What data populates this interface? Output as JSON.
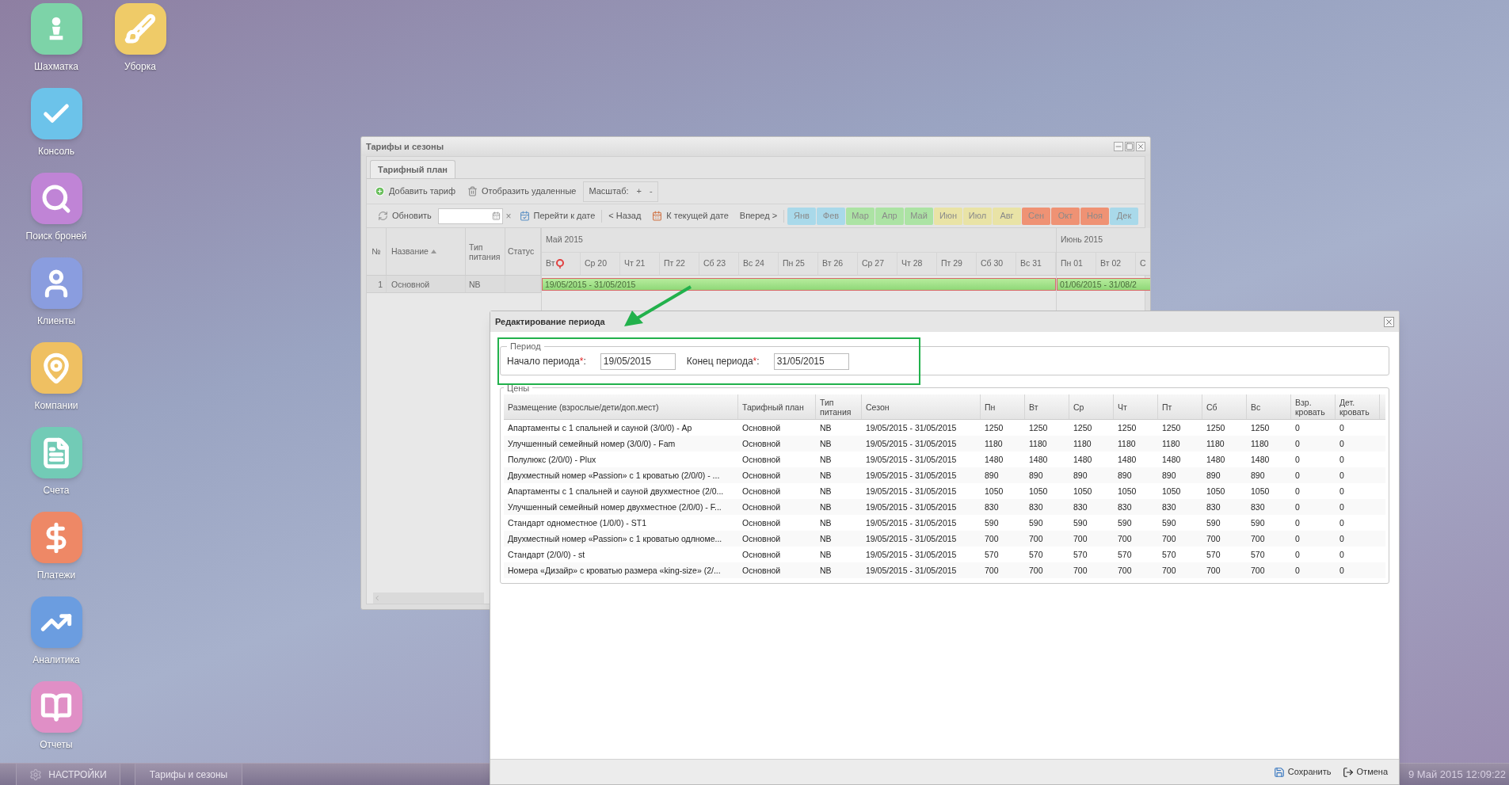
{
  "desktop_icons": [
    {
      "label": "Шахматка",
      "color": "#7dd3a8"
    },
    {
      "label": "Уборка",
      "color": "#efcb68"
    },
    {
      "label": "Консоль",
      "color": "#6cc3ea"
    },
    {
      "label": "Поиск броней",
      "color": "#c084d6"
    },
    {
      "label": "Клиенты",
      "color": "#8a9ddf"
    },
    {
      "label": "Компании",
      "color": "#efc062"
    },
    {
      "label": "Счета",
      "color": "#72cbb6"
    },
    {
      "label": "Платежи",
      "color": "#ee8866"
    },
    {
      "label": "Аналитика",
      "color": "#6b9de0"
    },
    {
      "label": "Отчеты",
      "color": "#e08fc6"
    }
  ],
  "taskbar": {
    "items": [
      {
        "label": "НАСТРОЙКИ",
        "kind": "settings"
      },
      {
        "label": "Тарифы и сезоны",
        "kind": "window"
      }
    ],
    "clock": "9 Май 2015 12:09:22"
  },
  "window": {
    "title": "Тарифы и сезоны",
    "tabs": [
      {
        "label": "Тарифный план",
        "selected": true
      }
    ],
    "toolbar": {
      "buttons": [
        {
          "label": "Добавить тариф",
          "kind": "add"
        },
        {
          "label": "Отобразить удаленные",
          "kind": "trash"
        }
      ],
      "scale": {
        "label": "Масштаб:",
        "zoom_in": "+",
        "zoom_out": "-"
      }
    },
    "navigation": {
      "refresh": "Обновить",
      "clear": "×",
      "go_to_date": "Перейти к дате",
      "back": "< Назад",
      "today": "К текущей дате",
      "forward": "Вперед >",
      "months": [
        {
          "label": "Янв",
          "color": "#a9d9ea"
        },
        {
          "label": "Фев",
          "color": "#a9d9ea"
        },
        {
          "label": "Мар",
          "color": "#ace3a4"
        },
        {
          "label": "Апр",
          "color": "#ace3a4"
        },
        {
          "label": "Май",
          "color": "#ace3a4"
        },
        {
          "label": "Июн",
          "color": "#e9e3a6"
        },
        {
          "label": "Июл",
          "color": "#e9e3a6"
        },
        {
          "label": "Авг",
          "color": "#e9e3a6"
        },
        {
          "label": "Сен",
          "color": "#ef9274"
        },
        {
          "label": "Окт",
          "color": "#ef9274"
        },
        {
          "label": "Ноя",
          "color": "#ef9274"
        },
        {
          "label": "Дек",
          "color": "#a9d9ea"
        }
      ]
    },
    "grid": {
      "columns": [
        {
          "label": "№",
          "sorted": false
        },
        {
          "label": "Название",
          "sorted": true
        },
        {
          "label": "Тип питания",
          "sorted": false
        },
        {
          "label": "Статус",
          "sorted": false
        }
      ],
      "rows": [
        [
          "1",
          "Основной",
          "NB"
        ]
      ]
    },
    "timeline": {
      "months": [
        {
          "label": "Май 2015",
          "bar": "19/05/2015 - 31/05/2015",
          "days": [
            {
              "label": "Вт",
              "today": true
            },
            {
              "label": "Ср 20",
              "today": false
            },
            {
              "label": "Чт 21",
              "today": false
            },
            {
              "label": "Пт 22",
              "today": false
            },
            {
              "label": "Сб 23",
              "today": false
            },
            {
              "label": "Вс 24",
              "today": false
            },
            {
              "label": "Пн 25",
              "today": false
            },
            {
              "label": "Вт 26",
              "today": false
            },
            {
              "label": "Ср 27",
              "today": false
            },
            {
              "label": "Чт 28",
              "today": false
            },
            {
              "label": "Пт 29",
              "today": false
            },
            {
              "label": "Сб 30",
              "today": false
            },
            {
              "label": "Вс 31",
              "today": false
            }
          ]
        },
        {
          "label": "Июнь 2015",
          "bar": "01/06/2015 - 31/08/2",
          "days": [
            {
              "label": "Пн 01",
              "today": false
            },
            {
              "label": "Вт 02",
              "today": false
            },
            {
              "label": "С",
              "today": false
            }
          ]
        }
      ]
    }
  },
  "dialog": {
    "title": "Редактирование периода",
    "period": {
      "legend": "Период",
      "fields": [
        {
          "label": "Начало периода",
          "mark": "*",
          "suffix": ":",
          "value": "19/05/2015"
        },
        {
          "label": "Конец периода",
          "mark": "*",
          "suffix": ":",
          "value": "31/05/2015"
        }
      ]
    },
    "prices": {
      "legend": "Цены",
      "columns": [
        "Размещение (взрослые/дети/доп.мест)",
        "Тарифный план",
        "Тип питания",
        "Сезон",
        "Пн",
        "Вт",
        "Ср",
        "Чт",
        "Пт",
        "Сб",
        "Вс",
        "Взр. кровать",
        "Дет. кровать"
      ],
      "rows": [
        [
          "Апартаменты с 1 спальней и сауной (3/0/0) - Ap",
          "Основной",
          "NB",
          "19/05/2015 - 31/05/2015",
          "1250",
          "1250",
          "1250",
          "1250",
          "1250",
          "1250",
          "1250",
          "0",
          "0"
        ],
        [
          "Улучшенный семейный номер (3/0/0) - Fam",
          "Основной",
          "NB",
          "19/05/2015 - 31/05/2015",
          "1180",
          "1180",
          "1180",
          "1180",
          "1180",
          "1180",
          "1180",
          "0",
          "0"
        ],
        [
          "Полулюкс (2/0/0) - Plux",
          "Основной",
          "NB",
          "19/05/2015 - 31/05/2015",
          "1480",
          "1480",
          "1480",
          "1480",
          "1480",
          "1480",
          "1480",
          "0",
          "0"
        ],
        [
          "Двухместный номер «Passion» с 1 кроватью (2/0/0) - ...",
          "Основной",
          "NB",
          "19/05/2015 - 31/05/2015",
          "890",
          "890",
          "890",
          "890",
          "890",
          "890",
          "890",
          "0",
          "0"
        ],
        [
          "Апартаменты с 1 спальней и сауной двухместное (2/0...",
          "Основной",
          "NB",
          "19/05/2015 - 31/05/2015",
          "1050",
          "1050",
          "1050",
          "1050",
          "1050",
          "1050",
          "1050",
          "0",
          "0"
        ],
        [
          "Улучшенный семейный номер двухместное (2/0/0) - F...",
          "Основной",
          "NB",
          "19/05/2015 - 31/05/2015",
          "830",
          "830",
          "830",
          "830",
          "830",
          "830",
          "830",
          "0",
          "0"
        ],
        [
          "Стандарт одноместное (1/0/0) - ST1",
          "Основной",
          "NB",
          "19/05/2015 - 31/05/2015",
          "590",
          "590",
          "590",
          "590",
          "590",
          "590",
          "590",
          "0",
          "0"
        ],
        [
          "Двухместный номер «Passion» с 1 кроватью одлноме...",
          "Основной",
          "NB",
          "19/05/2015 - 31/05/2015",
          "700",
          "700",
          "700",
          "700",
          "700",
          "700",
          "700",
          "0",
          "0"
        ],
        [
          "Стандарт (2/0/0) - st",
          "Основной",
          "NB",
          "19/05/2015 - 31/05/2015",
          "570",
          "570",
          "570",
          "570",
          "570",
          "570",
          "570",
          "0",
          "0"
        ],
        [
          "Номера «Дизайр» с кроватью размера «king-size» (2/...",
          "Основной",
          "NB",
          "19/05/2015 - 31/05/2015",
          "700",
          "700",
          "700",
          "700",
          "700",
          "700",
          "700",
          "0",
          "0"
        ]
      ]
    },
    "buttons": [
      {
        "label": "Сохранить",
        "kind": "save"
      },
      {
        "label": "Отмена",
        "kind": "cancel"
      }
    ]
  }
}
